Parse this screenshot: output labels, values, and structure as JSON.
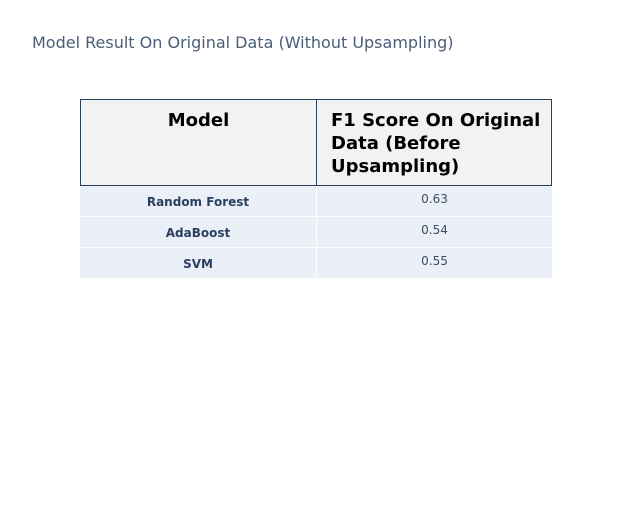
{
  "title": "Model Result On Original Data (Without Upsampling)",
  "chart_data": {
    "type": "table",
    "title": "Model Result On Original Data (Without Upsampling)",
    "columns": [
      "Model",
      "F1 Score On Original Data (Before Upsampling)"
    ],
    "rows": [
      {
        "model": "Random Forest",
        "f1": "0.63"
      },
      {
        "model": "AdaBoost",
        "f1": "0.54"
      },
      {
        "model": "SVM",
        "f1": "0.55"
      }
    ]
  },
  "colors": {
    "header_fill": "#f2f2f2",
    "header_border": "#2a3f5f",
    "cell_fill": "#ebf0f8",
    "text": "#2a3f5f"
  }
}
